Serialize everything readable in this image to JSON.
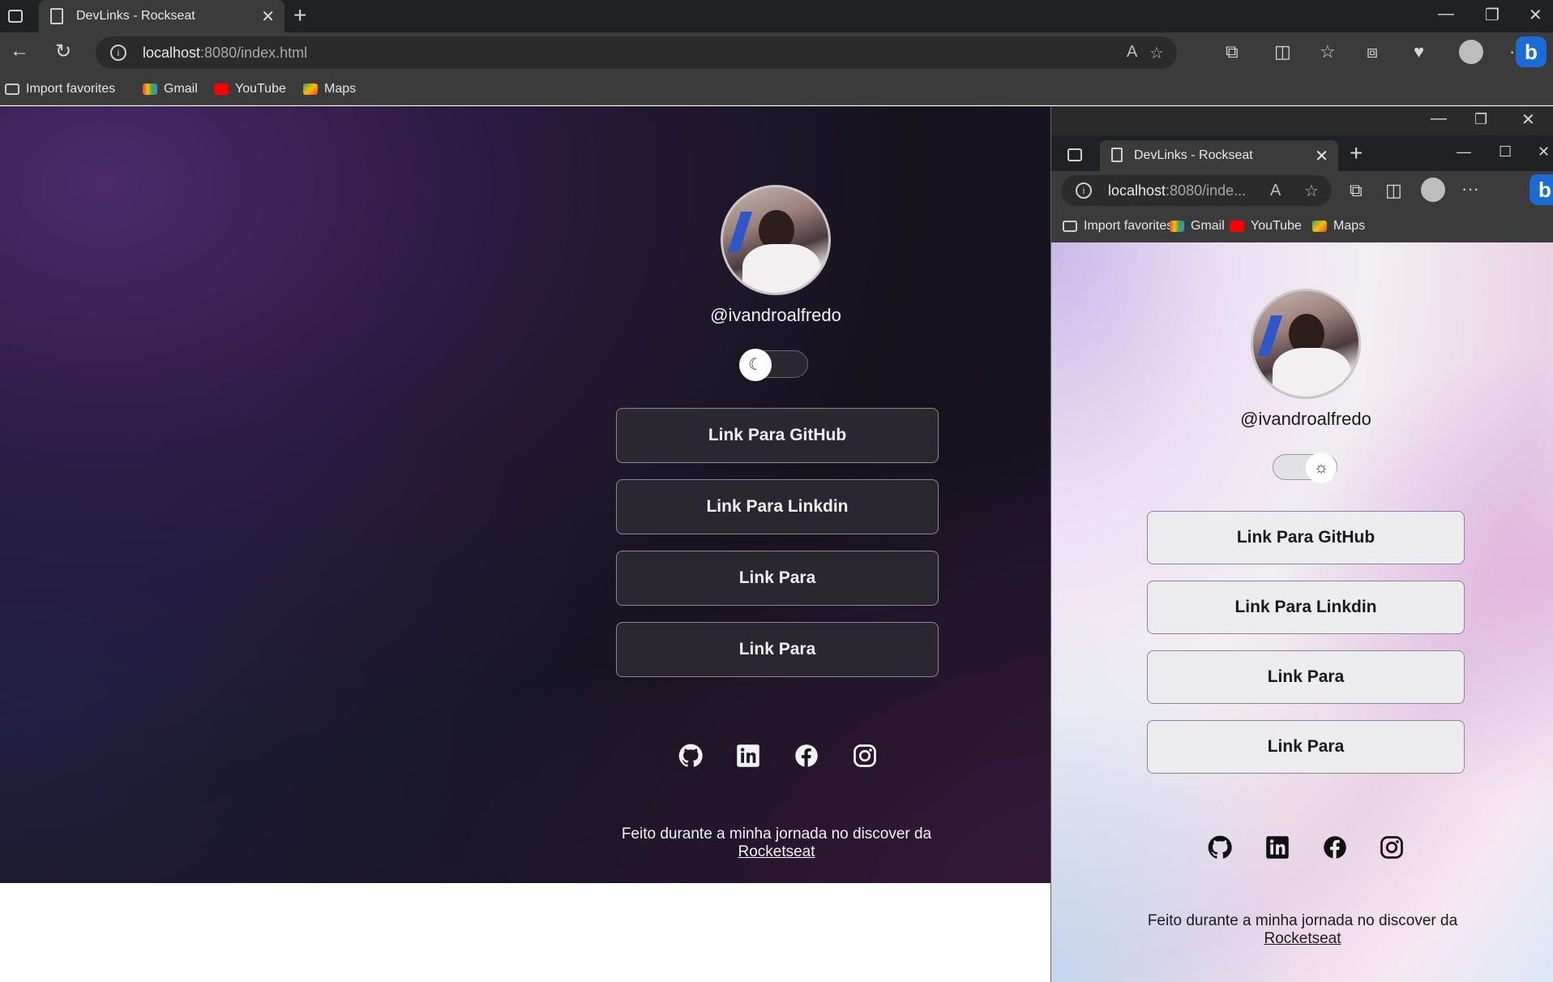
{
  "main_browser": {
    "tab_title": "DevLinks - Rockseat",
    "url_host": "localhost",
    "url_path": ":8080/index.html",
    "bookmarks": [
      "Import favorites",
      "Gmail",
      "YouTube",
      "Maps"
    ]
  },
  "dark_page": {
    "username": "@ivandroalfredo",
    "theme": "dark",
    "links": [
      "Link Para GitHub",
      "Link Para Linkdin",
      "Link Para",
      "Link Para"
    ],
    "social_icons": [
      "github-icon",
      "linkedin-icon",
      "facebook-icon",
      "instagram-icon"
    ],
    "footer_text": "Feito durante a minha jornada no discover da",
    "footer_link": "Rocketseat"
  },
  "second_browser": {
    "tab_title": "DevLinks - Rockseat",
    "url_host": "localhost",
    "url_path": ":8080/inde...",
    "bookmarks": [
      "Import favorites",
      "Gmail",
      "YouTube",
      "Maps"
    ]
  },
  "light_page": {
    "username": "@ivandroalfredo",
    "theme": "light",
    "links": [
      "Link Para GitHub",
      "Link Para Linkdin",
      "Link Para",
      "Link Para"
    ],
    "social_icons": [
      "github-icon",
      "linkedin-icon",
      "facebook-icon",
      "instagram-icon"
    ],
    "footer_text": "Feito durante a minha jornada no discover da",
    "footer_link": "Rocketseat"
  },
  "colors": {
    "chrome_dark": "#202124",
    "chrome_toolbar": "#3b3b3b",
    "dark_button_bg": "#2a2730",
    "light_button_bg": "#ecebee",
    "bing_blue": "#1b6bd6"
  }
}
